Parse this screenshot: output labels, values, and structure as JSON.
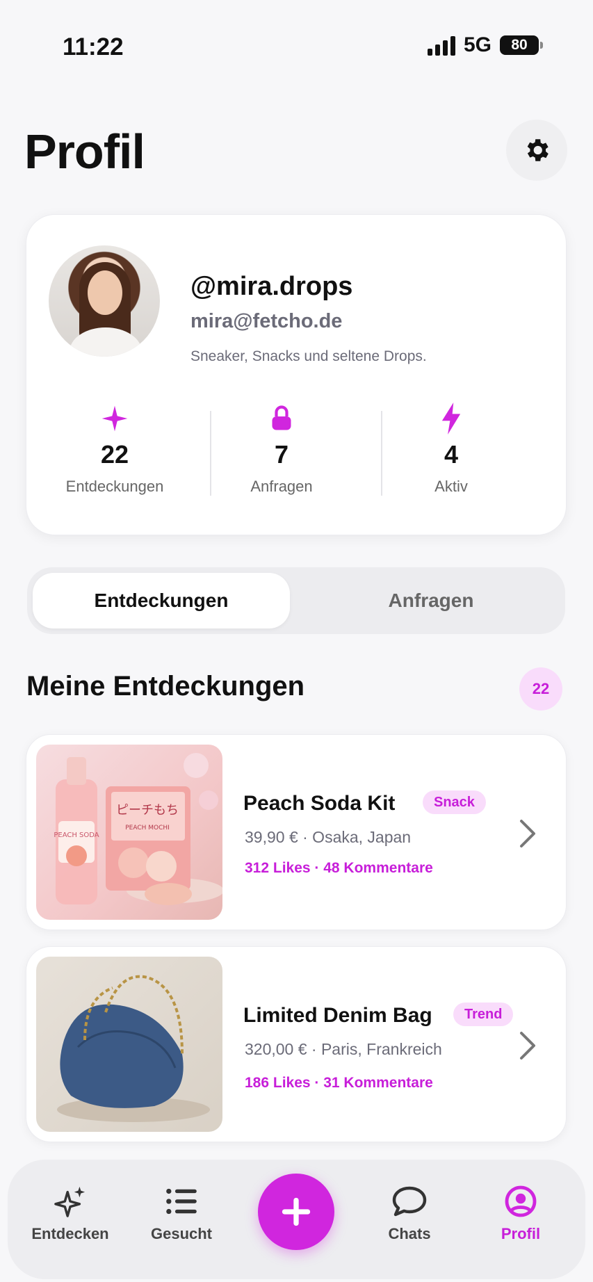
{
  "status_bar": {
    "time": "11:22",
    "network": "5G",
    "battery": "80"
  },
  "header": {
    "title": "Profil"
  },
  "profile": {
    "handle": "@mira.drops",
    "email": "mira@fetcho.de",
    "bio": "Sneaker, Snacks und seltene Drops.",
    "stats": [
      {
        "icon": "sparkle-icon",
        "value": "22",
        "label": "Entdeckungen"
      },
      {
        "icon": "lock-icon",
        "value": "7",
        "label": "Anfragen"
      },
      {
        "icon": "lightning-icon",
        "value": "4",
        "label": "Aktiv"
      }
    ]
  },
  "tabs": [
    {
      "label": "Entdeckungen",
      "active": true
    },
    {
      "label": "Anfragen",
      "active": false
    }
  ],
  "section": {
    "title": "Meine Entdeckungen",
    "count": "22"
  },
  "items": [
    {
      "title": "Peach Soda Kit",
      "tag": "Snack",
      "meta": "39,90 € · Osaka, Japan",
      "engagement": "312 Likes · 48 Kommentare",
      "image_text_bottle": "PEACH SODA",
      "image_text_box": "ピーチもち",
      "image_text_box_sub": "PEACH MOCHI"
    },
    {
      "title": "Limited Denim Bag",
      "tag": "Trend",
      "meta": "320,00 € · Paris, Frankreich",
      "engagement": "186 Likes · 31 Kommentare"
    }
  ],
  "bottom_nav": [
    {
      "label": "Entdecken",
      "icon": "sparkles-icon",
      "active": false
    },
    {
      "label": "Gesucht",
      "icon": "list-icon",
      "active": false
    },
    {
      "label": "",
      "icon": "plus-icon",
      "active": false
    },
    {
      "label": "Chats",
      "icon": "chat-bubble-icon",
      "active": false
    },
    {
      "label": "Profil",
      "icon": "user-circle-icon",
      "active": true
    }
  ],
  "colors": {
    "accent": "#d026de",
    "accent_soft": "#f9dcfb",
    "background": "#f7f7f9"
  }
}
